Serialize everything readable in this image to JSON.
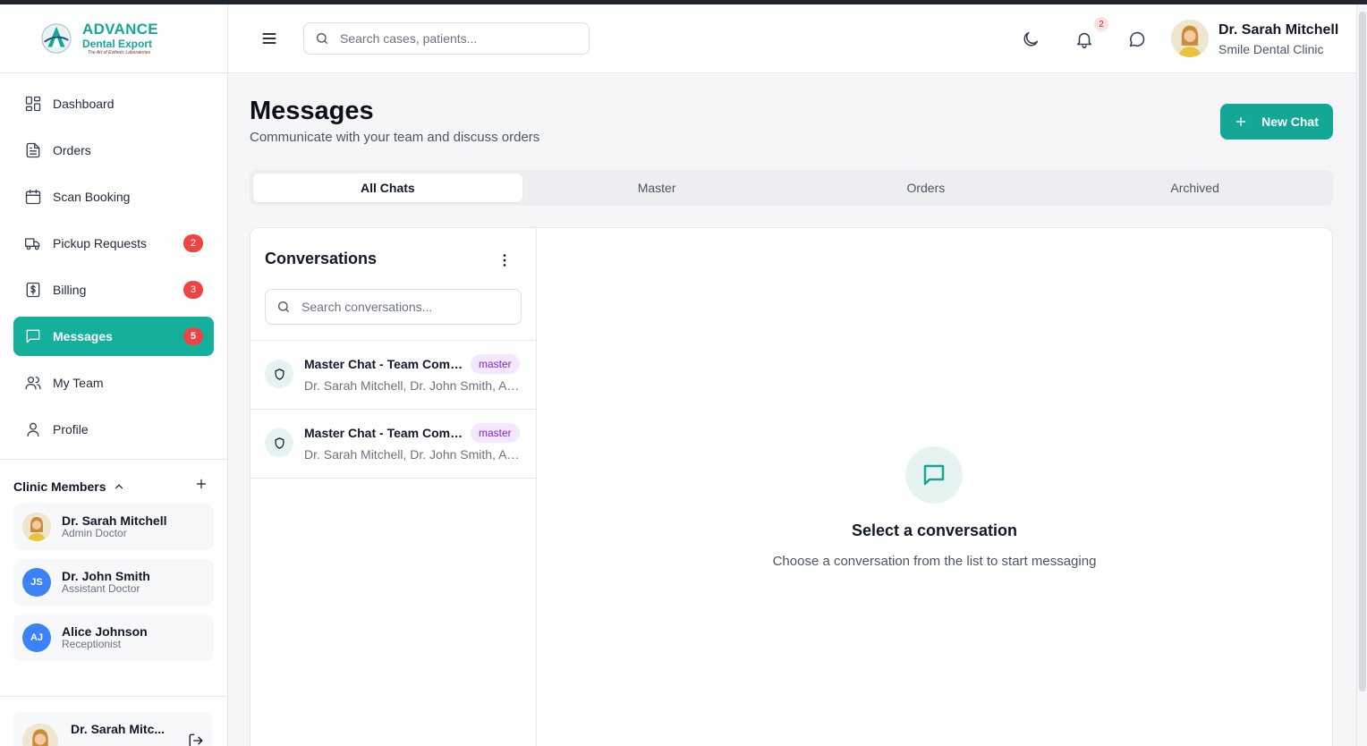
{
  "brand": {
    "line1": "ADVANCE",
    "line2": "Dental Export",
    "tagline": "The Art of Esthetic Laboratories",
    "accent": "#14a796"
  },
  "sidebar": {
    "items": [
      {
        "label": "Dashboard",
        "icon": "dashboard-icon",
        "badge": ""
      },
      {
        "label": "Orders",
        "icon": "document-icon",
        "badge": ""
      },
      {
        "label": "Scan Booking",
        "icon": "calendar-icon",
        "badge": ""
      },
      {
        "label": "Pickup Requests",
        "icon": "truck-icon",
        "badge": "2"
      },
      {
        "label": "Billing",
        "icon": "dollar-icon",
        "badge": "3"
      },
      {
        "label": "Messages",
        "icon": "chat-icon",
        "badge": "5",
        "active": true
      },
      {
        "label": "My Team",
        "icon": "users-icon",
        "badge": ""
      },
      {
        "label": "Profile",
        "icon": "user-icon",
        "badge": ""
      }
    ],
    "members_title": "Clinic Members",
    "members": [
      {
        "name": "Dr. Sarah Mitchell",
        "role": "Admin Doctor",
        "initials": ""
      },
      {
        "name": "Dr. John Smith",
        "role": "Assistant Doctor",
        "initials": "JS"
      },
      {
        "name": "Alice Johnson",
        "role": "Receptionist",
        "initials": "AJ"
      }
    ],
    "footer_user": "Dr. Sarah Mitc..."
  },
  "header": {
    "search_placeholder": "Search cases, patients...",
    "notification_count": "2",
    "user_name": "Dr. Sarah Mitchell",
    "clinic": "Smile Dental Clinic"
  },
  "main": {
    "title": "Messages",
    "subtitle": "Communicate with your team and discuss orders",
    "new_chat_label": "New Chat",
    "tabs": [
      {
        "label": "All Chats",
        "active": true
      },
      {
        "label": "Master"
      },
      {
        "label": "Orders"
      },
      {
        "label": "Archived"
      }
    ],
    "conversations_title": "Conversations",
    "conversation_search_placeholder": "Search conversations...",
    "conversations": [
      {
        "name": "Master Chat - Team Communication",
        "tag": "master",
        "members": "Dr. Sarah Mitchell, Dr. John Smith, Alice Johnson"
      },
      {
        "name": "Master Chat - Team Communication",
        "tag": "master",
        "members": "Dr. Sarah Mitchell, Dr. John Smith, Alice Johnson"
      }
    ],
    "empty_title": "Select a conversation",
    "empty_subtitle": "Choose a conversation from the list to start messaging"
  }
}
